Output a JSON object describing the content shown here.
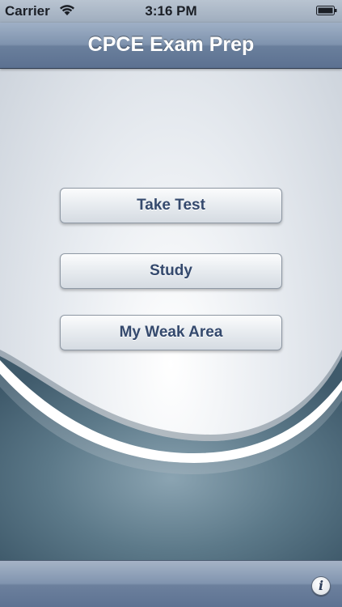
{
  "status_bar": {
    "carrier": "Carrier",
    "time": "3:16 PM",
    "wifi_icon": "wifi-icon",
    "battery_icon": "battery-icon"
  },
  "nav_bar": {
    "title": "CPCE Exam Prep"
  },
  "menu": {
    "take_test_label": "Take Test",
    "study_label": "Study",
    "weak_area_label": "My Weak Area"
  },
  "toolbar": {
    "info_icon": "info-icon",
    "info_glyph": "i"
  },
  "colors": {
    "nav_bar": "#7f93ae",
    "button_text": "#34496d",
    "wave_dark": "#4e6a7c",
    "page_background": "#e7ebf0"
  }
}
